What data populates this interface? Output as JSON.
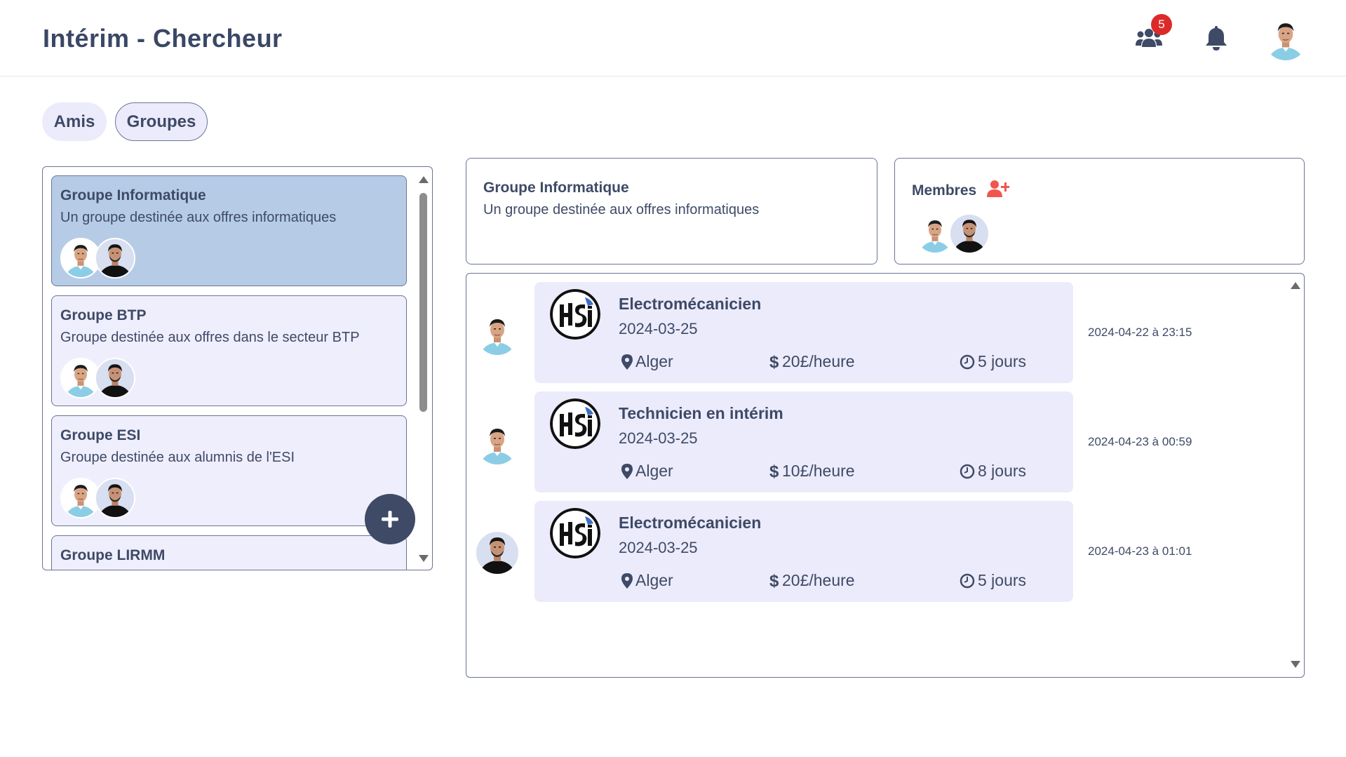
{
  "app": {
    "title": "Intérim - Chercheur"
  },
  "header": {
    "notification_count": "5",
    "icons": [
      "users-icon",
      "bell-icon",
      "avatar"
    ]
  },
  "tabs": [
    {
      "label": "Amis",
      "active": false
    },
    {
      "label": "Groupes",
      "active": true
    }
  ],
  "groups": [
    {
      "name": "Groupe Informatique",
      "description": "Un groupe destinée aux offres informatiques",
      "active": true
    },
    {
      "name": "Groupe BTP",
      "description": "Groupe destinée aux offres dans le secteur BTP",
      "active": false
    },
    {
      "name": "Groupe ESI",
      "description": "Groupe destinée aux alumnis de l'ESI",
      "active": false
    },
    {
      "name": "Groupe LIRMM",
      "description": "",
      "active": false
    }
  ],
  "selected_group": {
    "name": "Groupe Informatique",
    "description": "Un groupe destinée aux offres informatiques"
  },
  "members": {
    "title": "Membres"
  },
  "offers": [
    {
      "title": "Electromécanicien",
      "date": "2024-03-25",
      "location": "Alger",
      "pay": "20£/heure",
      "duration": "5 jours",
      "posted": "2024-04-22 à 23:15",
      "poster": "light"
    },
    {
      "title": "Technicien en intérim",
      "date": "2024-03-25",
      "location": "Alger",
      "pay": "10£/heure",
      "duration": "8 jours",
      "posted": "2024-04-23 à 00:59",
      "poster": "light"
    },
    {
      "title": "Electromécanicien",
      "date": "2024-03-25",
      "location": "Alger",
      "pay": "20£/heure",
      "duration": "5 jours",
      "posted": "2024-04-23 à 01:01",
      "poster": "dark"
    }
  ],
  "colors": {
    "accent": "#3e4a66",
    "card": "#ecebfb",
    "active_card": "#b6cce6",
    "badge": "#dc2a2a",
    "add_member": "#f0564f"
  }
}
